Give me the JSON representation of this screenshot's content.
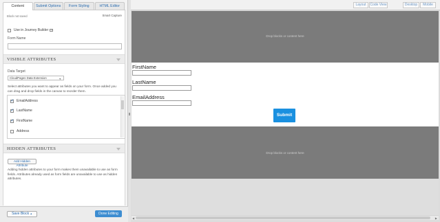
{
  "tabs": [
    {
      "label": "Content"
    },
    {
      "label": "Submit Options"
    },
    {
      "label": "Form Styling"
    },
    {
      "label": "HTML Editor"
    }
  ],
  "panel": {
    "block_status": "Block not saved",
    "smart_capture": "Smart Capture",
    "journey_builder_label": "Use in Journey Builder",
    "help_icon": "?",
    "form_name_label": "Form Name",
    "form_name_value": ""
  },
  "visible_attributes": {
    "title": "VISIBLE ATTRIBUTES",
    "data_target_label": "Data Target",
    "data_target_value": "CloudPages Data Extension",
    "description": "Select attributes you want to appear as fields on your form. Once added you can drag and drop fields in the canvas to reorder them.",
    "items": [
      {
        "label": "EmailAddress",
        "checked": true
      },
      {
        "label": "LastName",
        "checked": true
      },
      {
        "label": "FirstName",
        "checked": true
      },
      {
        "label": "Address",
        "checked": false
      }
    ]
  },
  "hidden_attributes": {
    "title": "HIDDEN ATTRIBUTES",
    "add_button": "Add Hidden Attribute",
    "description": "Adding hidden attributes to your form makes them unavailable to use as form fields. Attributes already used as form fields are unavailable to use as hidden attributes."
  },
  "footer": {
    "save_label": "Save Block",
    "save_caret": "▲",
    "done_label": "Done Editing"
  },
  "toolbar": {
    "layout": "Layout",
    "code_view": "Code View",
    "desktop": "Desktop",
    "mobile": "Mobile"
  },
  "canvas": {
    "drop_top": "Drop blocks or content here",
    "drop_bottom": "Drop blocks or content here",
    "fields": [
      {
        "label": "FirstName"
      },
      {
        "label": "LastName"
      },
      {
        "label": "EmailAddress"
      }
    ],
    "submit_label": "Submit"
  }
}
